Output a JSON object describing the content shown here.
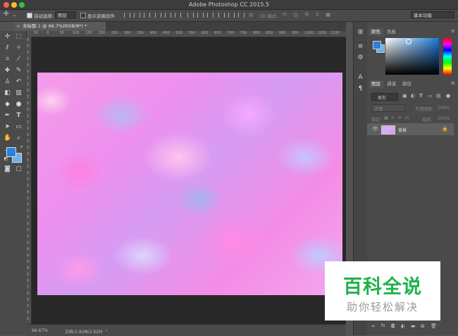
{
  "window": {
    "title": "Adobe Photoshop CC 2015.5"
  },
  "options_bar": {
    "auto_select_label": "自动选择:",
    "auto_select_value": "图层",
    "show_transform_label": "显示变换控件",
    "mode_3d_label": "3D 模式:",
    "workspace": "基本功能"
  },
  "document_tab": {
    "title": "未标题-1 @ 66.7%(RGB/8*) *",
    "close": "×"
  },
  "ruler": {
    "h_ticks": [
      "50",
      "0",
      "50",
      "100",
      "150",
      "200",
      "250",
      "300",
      "350",
      "400",
      "450",
      "500",
      "550",
      "600",
      "650",
      "700",
      "750",
      "800",
      "850",
      "900",
      "950",
      "1000",
      "1050",
      "1100"
    ],
    "v_ticks": [
      "0",
      "5",
      "0",
      "1",
      "0",
      "0",
      "1",
      "5",
      "0",
      "2",
      "0",
      "0",
      "2",
      "5",
      "0",
      "3",
      "0",
      "0",
      "3",
      "5",
      "0",
      "4",
      "0",
      "0",
      "4",
      "5",
      "0",
      "5",
      "0",
      "0",
      "5",
      "5",
      "0",
      "6",
      "0",
      "0",
      "6",
      "5",
      "0",
      "7",
      "0",
      "0",
      "7",
      "5",
      "0"
    ]
  },
  "status": {
    "zoom": "66.67%",
    "doc": "文档:2.92M/2.92M"
  },
  "color_panel": {
    "tab_color": "颜色",
    "tab_swatches": "色板",
    "fg": "#2d7fe0",
    "bg": "#6db0ea"
  },
  "layers_panel": {
    "tabs": [
      "图层",
      "通道",
      "路径"
    ],
    "filter_kind": "类型",
    "blend_mode": "正常",
    "opacity_label": "不透明度:",
    "opacity_value": "100%",
    "lock_label": "锁定:",
    "fill_label": "填充:",
    "fill_value": "100%",
    "layer_name": "背景"
  },
  "watermark": {
    "main": "百科全说",
    "sub": "助你轻松解决"
  }
}
